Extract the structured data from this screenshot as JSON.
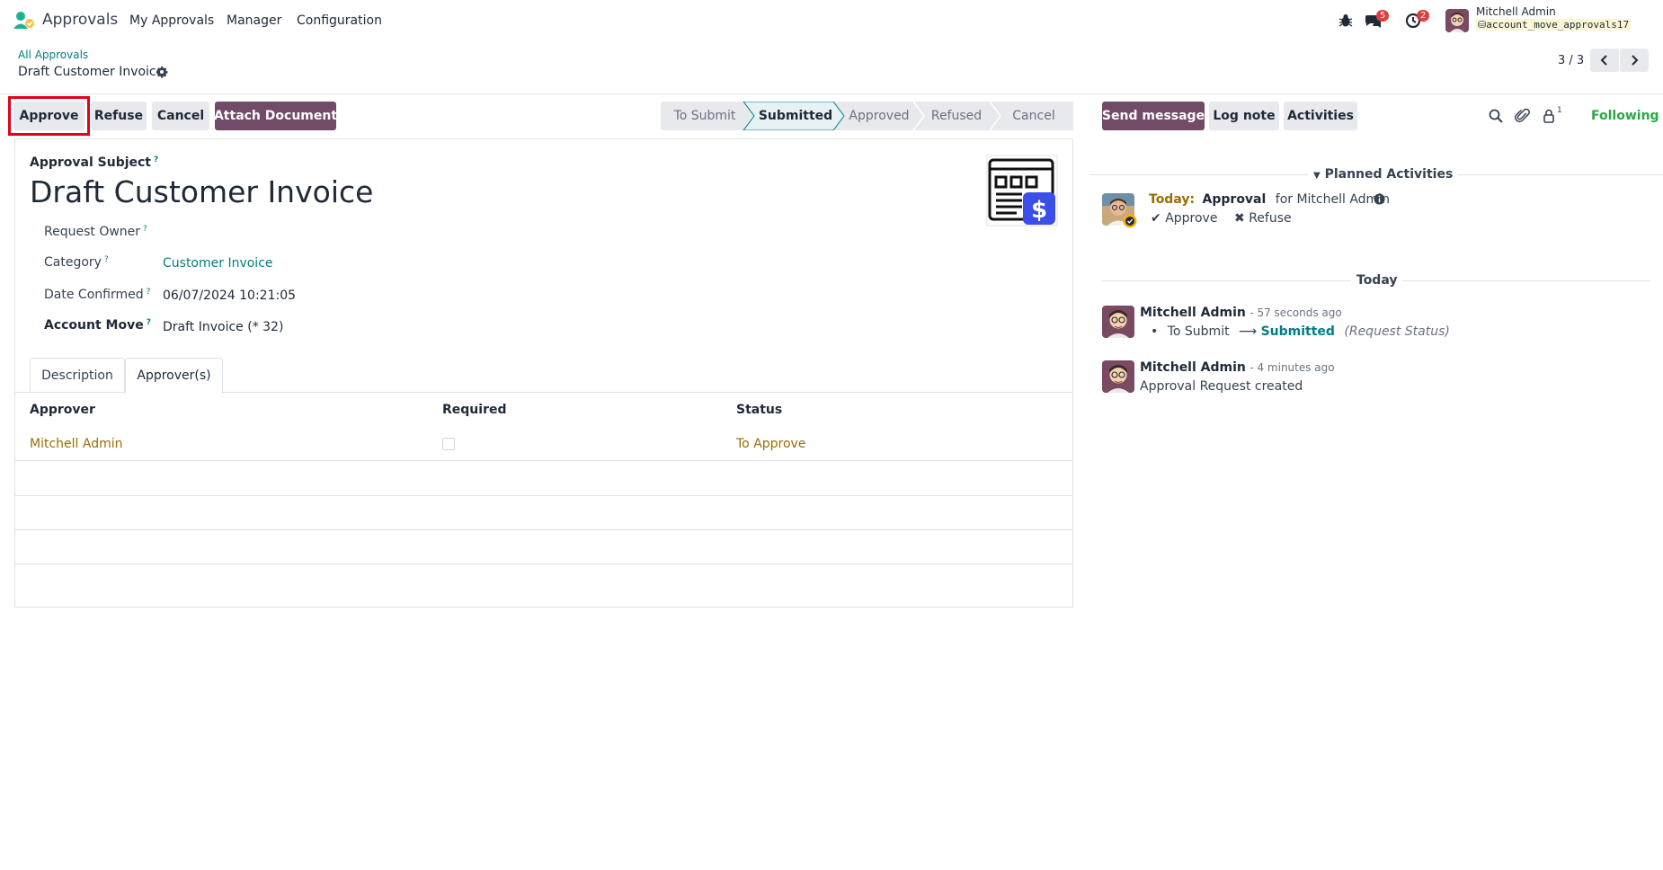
{
  "navbar": {
    "app_name": "Approvals",
    "menus": [
      "My Approvals",
      "Manager",
      "Configuration"
    ],
    "messages_badge": "5",
    "activities_badge": "2",
    "user_name": "Mitchell Admin",
    "db_name": "account_move_approvals17"
  },
  "control_panel": {
    "breadcrumb": "All Approvals",
    "record_title": "Draft Customer Invoice",
    "pager": "3 / 3"
  },
  "actions": {
    "approve": "Approve",
    "refuse": "Refuse",
    "cancel": "Cancel",
    "attach": "Attach Document"
  },
  "statusbar": {
    "items": [
      "To Submit",
      "Submitted",
      "Approved",
      "Refused",
      "Cancel"
    ],
    "current": "Submitted"
  },
  "form": {
    "subject_label": "Approval Subject",
    "help_mark": "?",
    "subject": "Draft Customer Invoice",
    "fields": {
      "request_owner_label": "Request Owner",
      "category_label": "Category",
      "category_value": "Customer Invoice",
      "date_label": "Date Confirmed",
      "date_value": "06/07/2024 10:21:05",
      "account_move_label": "Account Move",
      "account_move_value": "Draft Invoice (* 32)"
    },
    "tabs": [
      "Description",
      "Approver(s)"
    ],
    "table": {
      "headers": [
        "Approver",
        "Required",
        "Status"
      ],
      "rows": [
        {
          "approver": "Mitchell Admin",
          "required": false,
          "status": "To Approve"
        }
      ]
    }
  },
  "chatter": {
    "send_message": "Send message",
    "log_note": "Log note",
    "activities": "Activities",
    "followers_count": "1",
    "following": "Following",
    "planned_title": "Planned Activities",
    "activity": {
      "today": "Today:",
      "type": "Approval",
      "for": "for Mitchell Admin",
      "approve": "Approve",
      "refuse": "Refuse"
    },
    "today_separator": "Today",
    "messages": [
      {
        "author": "Mitchell Admin",
        "time": "- 57 seconds ago",
        "from": "To Submit",
        "to": "Submitted",
        "field": "(Request Status)"
      },
      {
        "author": "Mitchell Admin",
        "time": "- 4 minutes ago",
        "body": "Approval Request created"
      }
    ]
  },
  "colors": {
    "brand": "#714b67",
    "teal": "#017e84",
    "highlight": "#e4001b",
    "following": "#28a745"
  }
}
